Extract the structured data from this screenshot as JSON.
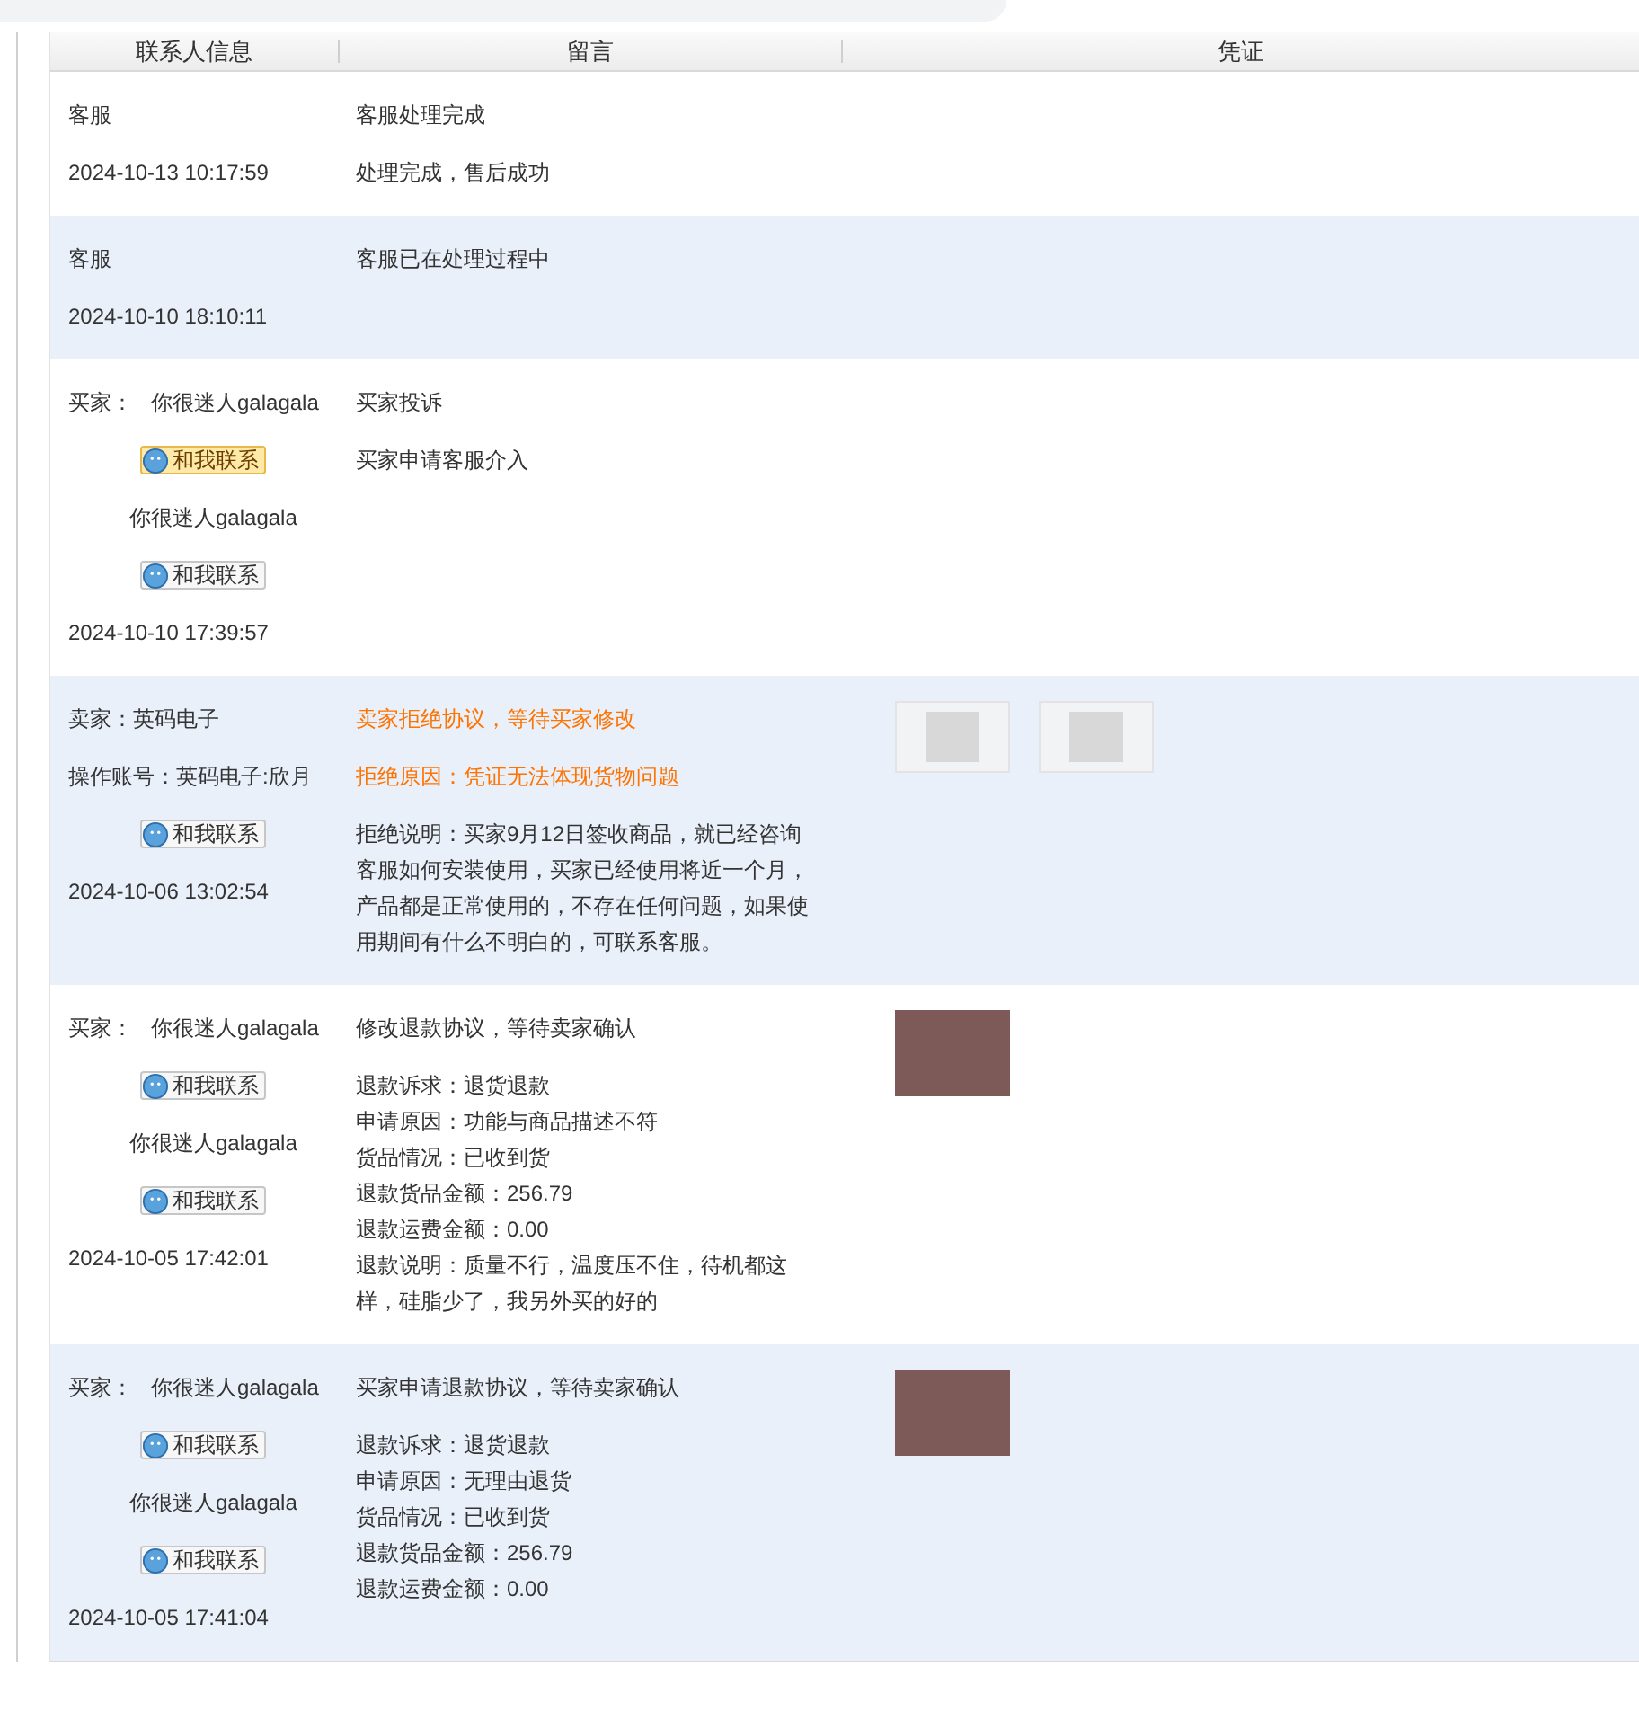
{
  "table": {
    "columns": [
      "联系人信息",
      "留言",
      "凭证"
    ],
    "rows": [
      {
        "contact": [
          {
            "kind": "name",
            "text": "客服"
          },
          {
            "kind": "time",
            "text": "2024-10-13 10:17:59"
          }
        ],
        "message": [
          {
            "kind": "text",
            "text": "客服处理完成"
          },
          {
            "kind": "text",
            "text": "处理完成，售后成功"
          }
        ],
        "evidence": []
      },
      {
        "contact": [
          {
            "kind": "name",
            "text": "客服"
          },
          {
            "kind": "time",
            "text": "2024-10-10 18:10:11"
          }
        ],
        "message": [
          {
            "kind": "text",
            "text": "客服已在处理过程中"
          }
        ],
        "evidence": []
      },
      {
        "contact": [
          {
            "kind": "party",
            "label": "买家：",
            "text": "你很迷人galagala"
          },
          {
            "kind": "button",
            "text": "和我联系",
            "highlighted": true
          },
          {
            "kind": "alias",
            "text": "你很迷人galagala"
          },
          {
            "kind": "button",
            "text": "和我联系",
            "highlighted": false
          },
          {
            "kind": "time",
            "text": "2024-10-10 17:39:57"
          }
        ],
        "message": [
          {
            "kind": "text",
            "text": "买家投诉"
          },
          {
            "kind": "text",
            "text": "买家申请客服介入"
          }
        ],
        "evidence": []
      },
      {
        "contact": [
          {
            "kind": "name",
            "text": "卖家：英码电子"
          },
          {
            "kind": "name",
            "text": "操作账号：英码电子:欣月"
          },
          {
            "kind": "button",
            "text": "和我联系",
            "highlighted": false
          },
          {
            "kind": "time",
            "text": "2024-10-06 13:02:54"
          }
        ],
        "message": [
          {
            "kind": "alert",
            "text": "卖家拒绝协议，等待买家修改"
          },
          {
            "kind": "alert",
            "text": "拒绝原因：凭证无法体现货物问题"
          },
          {
            "kind": "text",
            "text": "拒绝说明：买家9月12日签收商品，就已经咨询客服如何安装使用，买家已经使用将近一个月，产品都是正常使用的，不存在任何问题，如果使用期间有什么不明白的，可联系客服。"
          }
        ],
        "evidence": [
          {
            "kind": "screenshot"
          },
          {
            "kind": "screenshot"
          }
        ]
      },
      {
        "contact": [
          {
            "kind": "party",
            "label": "买家：",
            "text": "你很迷人galagala"
          },
          {
            "kind": "button",
            "text": "和我联系",
            "highlighted": false
          },
          {
            "kind": "alias",
            "text": "你很迷人galagala"
          },
          {
            "kind": "button",
            "text": "和我联系",
            "highlighted": false
          },
          {
            "kind": "time",
            "text": "2024-10-05 17:42:01"
          }
        ],
        "message": [
          {
            "kind": "text",
            "text": "修改退款协议，等待卖家确认"
          },
          {
            "kind": "list",
            "lines": [
              "退款诉求：退货退款",
              "申请原因：功能与商品描述不符",
              "货品情况：已收到货",
              "退款货品金额：256.79",
              "退款运费金额：0.00",
              "退款说明：质量不行，温度压不住，待机都这样，硅脂少了，我另外买的好的"
            ]
          }
        ],
        "evidence": [
          {
            "kind": "photo"
          }
        ]
      },
      {
        "contact": [
          {
            "kind": "party",
            "label": "买家：",
            "text": "你很迷人galagala"
          },
          {
            "kind": "button",
            "text": "和我联系",
            "highlighted": false
          },
          {
            "kind": "alias",
            "text": "你很迷人galagala"
          },
          {
            "kind": "button",
            "text": "和我联系",
            "highlighted": false
          },
          {
            "kind": "time",
            "text": "2024-10-05 17:41:04"
          }
        ],
        "message": [
          {
            "kind": "text",
            "text": "买家申请退款协议，等待卖家确认"
          },
          {
            "kind": "list",
            "lines": [
              "退款诉求：退货退款",
              "申请原因：无理由退货",
              "货品情况：已收到货",
              "退款货品金额：256.79",
              "退款运费金额：0.00"
            ]
          }
        ],
        "evidence": [
          {
            "kind": "photo"
          }
        ]
      }
    ]
  }
}
